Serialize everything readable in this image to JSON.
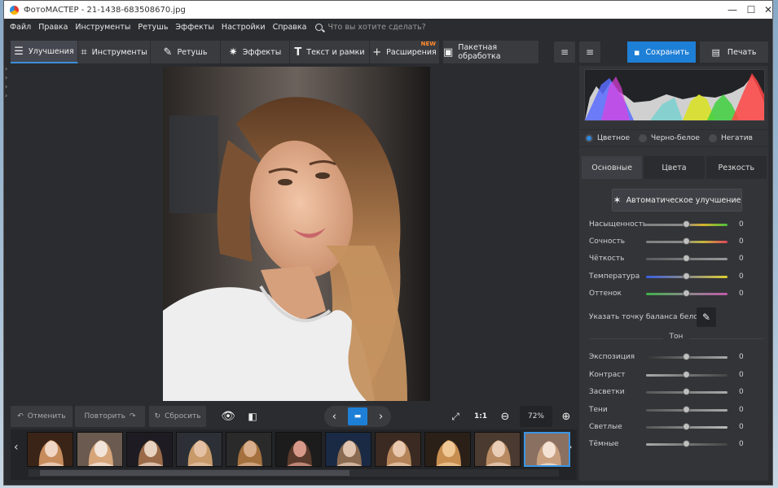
{
  "window": {
    "title": "ФотоМАСТЕР - 21-1438-683508670.jpg",
    "controls": [
      "—",
      "☐",
      "✕"
    ]
  },
  "menu": {
    "items": [
      "Файл",
      "Правка",
      "Инструменты",
      "Ретушь",
      "Эффекты",
      "Настройки",
      "Справка"
    ],
    "search_placeholder": "Что вы хотите сделать?"
  },
  "toolbar": {
    "tabs": [
      {
        "label": "Улучшения",
        "icon": "sliders-icon",
        "active": true
      },
      {
        "label": "Инструменты",
        "icon": "crop-icon",
        "active": false
      },
      {
        "label": "Ретушь",
        "icon": "brush-icon",
        "active": false
      },
      {
        "label": "Эффекты",
        "icon": "sparkle-icon",
        "active": false
      },
      {
        "label": "Текст и рамки",
        "icon": "text-icon",
        "active": false
      },
      {
        "label": "Расширения",
        "icon": "plus-icon",
        "active": false,
        "badge": "NEW"
      }
    ],
    "batch_label": "Пакетная обработка",
    "save_label": "Сохранить",
    "print_label": "Печать"
  },
  "color_mode": {
    "options": [
      "Цветное",
      "Черно-белое",
      "Негатив"
    ],
    "selected": "Цветное"
  },
  "panel_tabs": {
    "items": [
      "Основные",
      "Цвета",
      "Резкость"
    ],
    "active": "Основные"
  },
  "auto_enhance_label": "Автоматическое улучшение",
  "basic_sliders": [
    {
      "label": "Насыщенность",
      "value": "0"
    },
    {
      "label": "Сочность",
      "value": "0"
    },
    {
      "label": "Чёткость",
      "value": "0"
    },
    {
      "label": "Температура",
      "value": "0"
    },
    {
      "label": "Оттенок",
      "value": "0"
    }
  ],
  "white_balance_label": "Указать точку баланса белого",
  "tone_section_label": "Тон",
  "tone_sliders": [
    {
      "label": "Экспозиция",
      "value": "0"
    },
    {
      "label": "Контраст",
      "value": "0"
    },
    {
      "label": "Засветки",
      "value": "0"
    },
    {
      "label": "Тени",
      "value": "0"
    },
    {
      "label": "Светлые",
      "value": "0"
    },
    {
      "label": "Тёмные",
      "value": "0"
    }
  ],
  "bottom_bar": {
    "undo_label": "Отменить",
    "redo_label": "Повторить",
    "reset_label": "Сбросить",
    "fit_label": "1:1",
    "zoom_value": "72%"
  },
  "filmstrip": {
    "thumb_count": 11,
    "selected_index": 10
  },
  "colors": {
    "accent": "#1e7fd6",
    "panel_bg": "#333438",
    "window_bg": "#2b2c2f",
    "new_badge": "#ff8a2c"
  }
}
